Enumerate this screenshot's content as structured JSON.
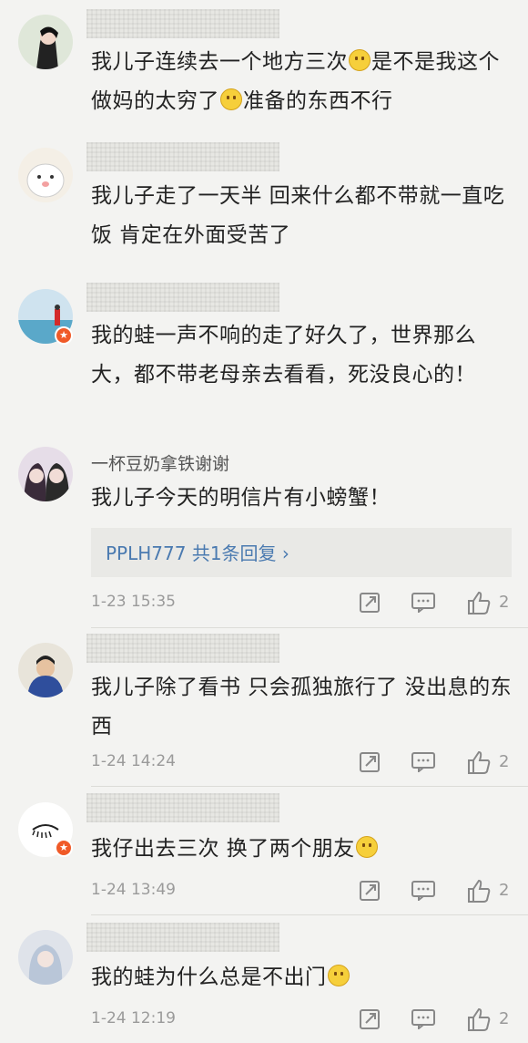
{
  "comments": [
    {
      "text": "我儿子连续去一个地方三次",
      "text2": "是不是我这个做妈的太穷了",
      "text3": "准备的东西不行"
    },
    {
      "text": "我儿子走了一天半 回来什么都不带就一直吃饭 肯定在外面受苦了"
    },
    {
      "text": "我的蛙一声不响的走了好久了，世界那么大，都不带老母亲去看看，死没良心的！"
    },
    {
      "username": "一杯豆奶拿铁谢谢",
      "text": "我儿子今天的明信片有小螃蟹！",
      "reply_link": "PPLH777  共1条回复 ›",
      "time": "1-23 15:35",
      "likes": "2"
    },
    {
      "text": "我儿子除了看书 只会孤独旅行了 没出息的东西",
      "time": "1-24 14:24",
      "likes": "2"
    },
    {
      "text": "我仔出去三次 换了两个朋友",
      "time": "1-24 13:49",
      "likes": "2"
    },
    {
      "text": "我的蛙为什么总是不出门",
      "time": "1-24 12:19",
      "likes": "2"
    }
  ],
  "icons": {
    "share": "share-icon",
    "comment": "comment-icon",
    "like": "thumbs-up-icon",
    "verified": "verified-badge-icon"
  },
  "colors": {
    "link": "#4a7ab0",
    "badge": "#f05a28",
    "meta": "#9a9a9a"
  }
}
